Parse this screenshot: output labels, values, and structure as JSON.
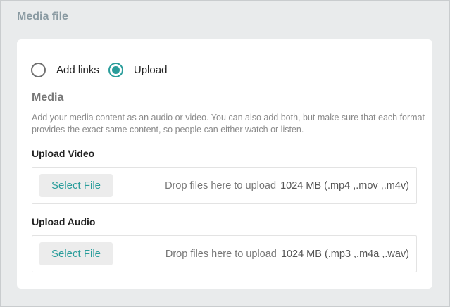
{
  "section": {
    "title": "Media file"
  },
  "source": {
    "options": [
      {
        "label": "Add links",
        "checked": false
      },
      {
        "label": "Upload",
        "checked": true
      }
    ]
  },
  "media": {
    "heading": "Media",
    "description": "Add your media content as an audio or video. You can also add both, but make sure that each format provides the exact same content, so people can either watch or listen."
  },
  "uploads": {
    "video": {
      "label": "Upload Video",
      "button": "Select File",
      "drop_text": "Drop files here to upload",
      "limits": "1024 MB (.mp4 ,.mov ,.m4v)"
    },
    "audio": {
      "label": "Upload Audio",
      "button": "Select File",
      "drop_text": "Drop files here to upload",
      "limits": "1024 MB (.mp3 ,.m4a ,.wav)"
    }
  },
  "colors": {
    "accent": "#2a9d9b",
    "background": "#e9ebec"
  }
}
